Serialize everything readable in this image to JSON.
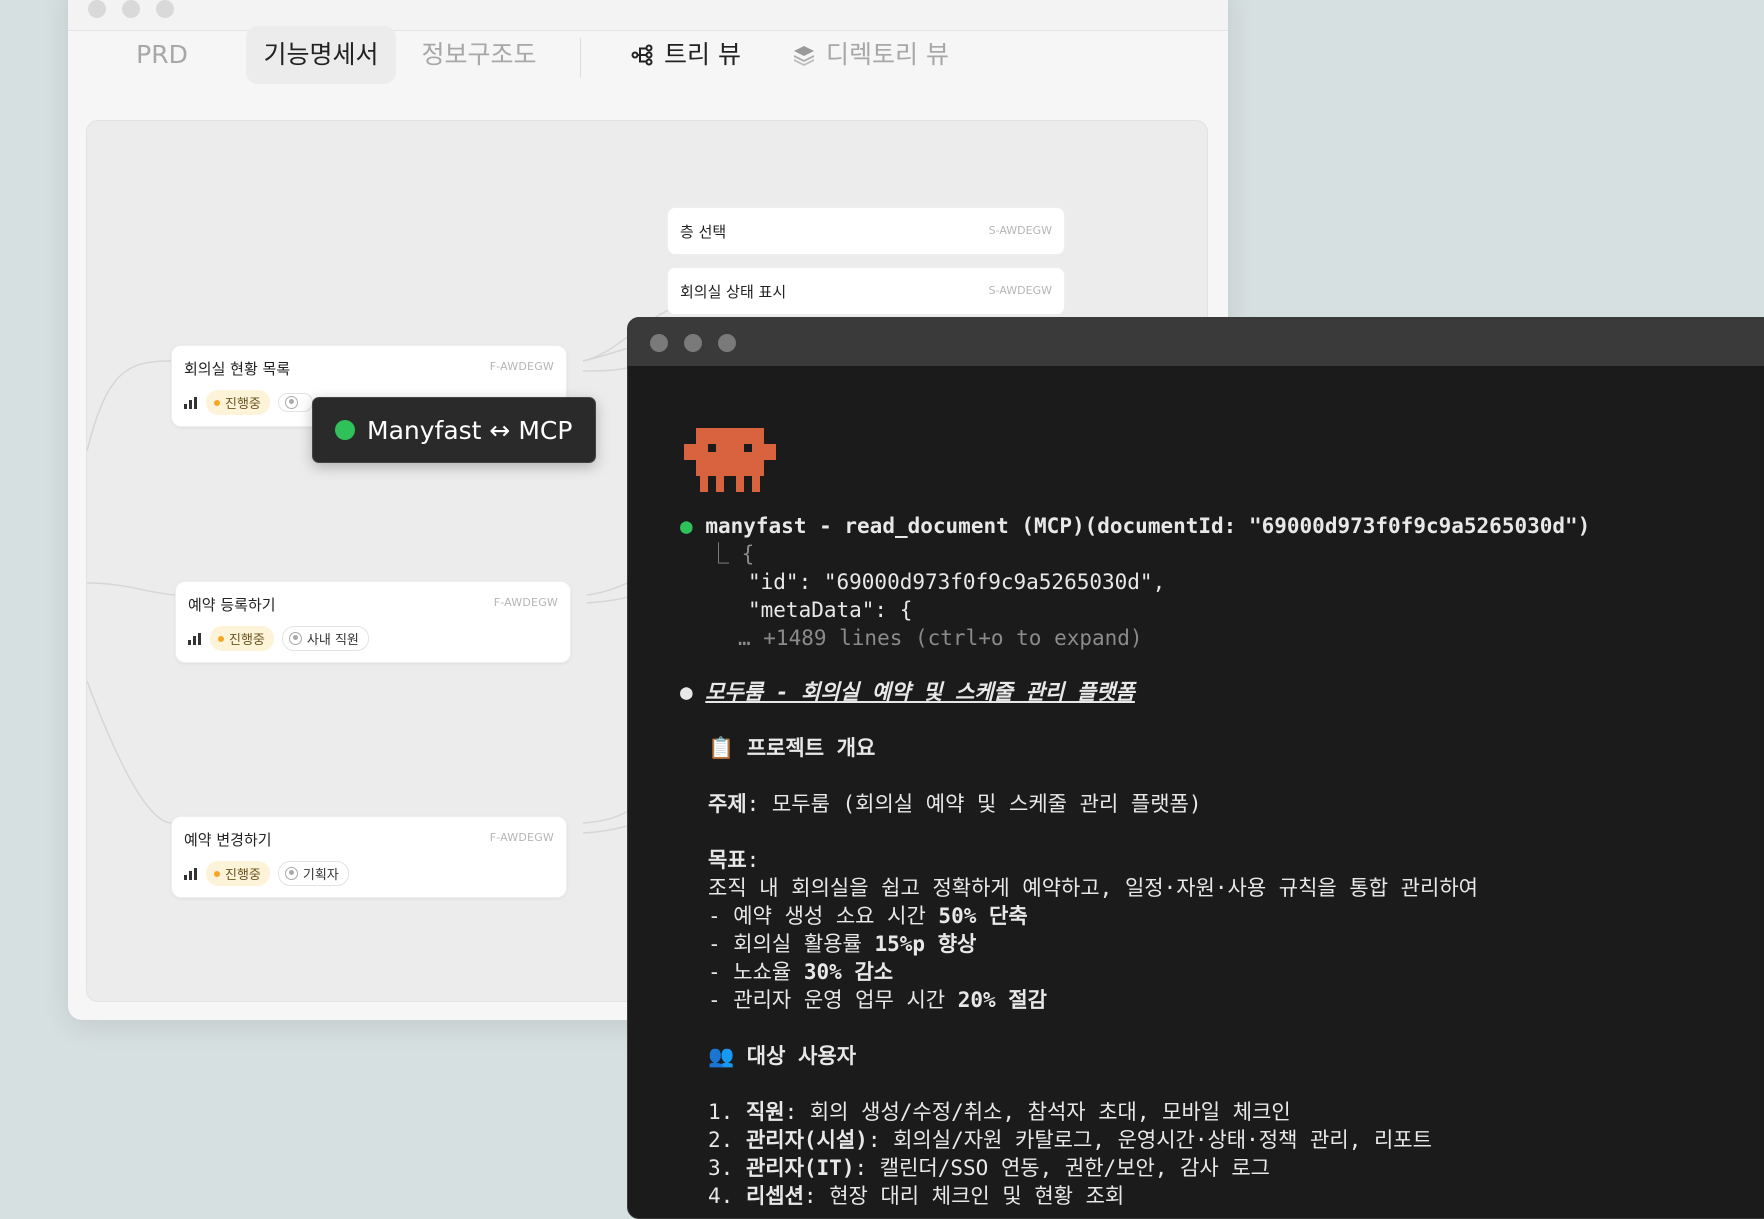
{
  "back_window": {
    "tabs": {
      "prd": "PRD",
      "spec": "기능명세서",
      "ia": "정보구조도"
    },
    "views": {
      "tree": "트리 뷰",
      "directory": "디렉토리 뷰"
    },
    "side_nodes": [
      {
        "title": "층 선택",
        "code": "S-AWDEGW"
      },
      {
        "title": "회의실 상태 표시",
        "code": "S-AWDEGW"
      }
    ],
    "nodes": [
      {
        "title": "회의실 현황 목록",
        "code": "F-AWDEGW",
        "status": "진행중",
        "user": ""
      },
      {
        "title": "예약 등록하기",
        "code": "F-AWDEGW",
        "status": "진행중",
        "user": "사내 직원"
      },
      {
        "title": "예약 변경하기",
        "code": "F-AWDEGW",
        "status": "진행중",
        "user": "기획자"
      }
    ]
  },
  "mcp_badge": {
    "label": "Manyfast ↔ MCP",
    "color": "#2fc25b"
  },
  "terminal": {
    "call": "manyfast - read_document (MCP)(documentId: \"69000d973f0f9c9a5265030d\")",
    "result_open": "⎿ {",
    "result_id": "\"id\": \"69000d973f0f9c9a5265030d\",",
    "result_meta": "\"metaData\": {",
    "result_more": "… +1489 lines (ctrl+o to expand)",
    "doc_title": "모두룸 - 회의실 예약 및 스케줄 관리 플랫폼",
    "overview_heading": "📋 프로젝트 개요",
    "subject_label": "주제",
    "subject_value": ": 모두룸 (회의실 예약 및 스케줄 관리 플랫폼)",
    "goal_label": "목표",
    "goal_colon": ":",
    "goal_desc": "조직 내 회의실을 쉽고 정확하게 예약하고, 일정·자원·사용 규칙을 통합 관리하여",
    "goals": [
      {
        "prefix": "- 예약 생성 소요 시간 ",
        "strong": "50% 단축"
      },
      {
        "prefix": "- 회의실 활용률 ",
        "strong": "15%p 향상"
      },
      {
        "prefix": "- 노쇼율 ",
        "strong": "30% 감소"
      },
      {
        "prefix": "- 관리자 운영 업무 시간 ",
        "strong": "20% 절감"
      }
    ],
    "users_heading": "👥 대상 사용자",
    "users": [
      {
        "num": "1. ",
        "role": "직원",
        "desc": ": 회의 생성/수정/취소, 참석자 초대, 모바일 체크인"
      },
      {
        "num": "2. ",
        "role": "관리자(시설)",
        "desc": ": 회의실/자원 카탈로그, 운영시간·상태·정책 관리, 리포트"
      },
      {
        "num": "3. ",
        "role": "관리자(IT)",
        "desc": ": 캘린더/SSO 연동, 권한/보안, 감사 로그"
      },
      {
        "num": "4. ",
        "role": "리셉션",
        "desc": ": 현장 대리 체크인 및 현황 조회"
      }
    ]
  }
}
